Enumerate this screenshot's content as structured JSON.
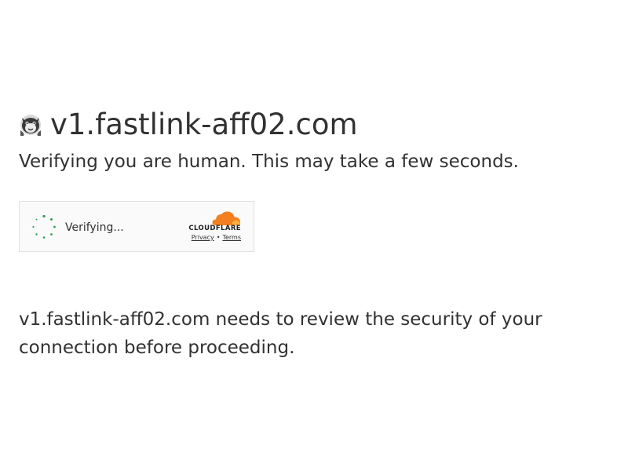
{
  "header": {
    "site_title": "v1.fastlink-aff02.com",
    "favicon_icon": "site-favicon-icon"
  },
  "subtitle": "Verifying you are human. This may take a few seconds.",
  "widget": {
    "status_text": "Verifying...",
    "spinner_icon": "loading-spinner-icon",
    "spinner_color": "#2e9e4f",
    "brand_wordmark": "CLOUDFLARE",
    "brand_cloud_color": "#f38020",
    "privacy_link": "Privacy",
    "separator": "•",
    "terms_link": "Terms"
  },
  "body": {
    "message": "v1.fastlink-aff02.com needs to review the security of your connection before proceeding."
  }
}
